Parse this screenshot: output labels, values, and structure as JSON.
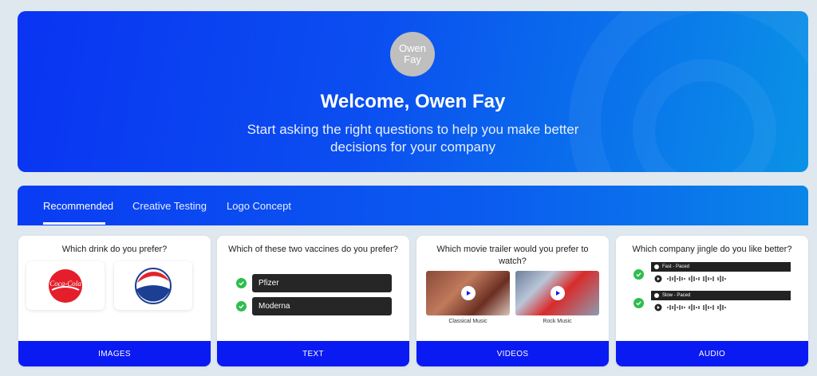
{
  "hero": {
    "avatar_text": "Owen Fay",
    "welcome": "Welcome, Owen Fay",
    "subtitle": "Start asking the right questions to help you make better decisions for your company"
  },
  "tabs": [
    {
      "label": "Recommended",
      "active": true
    },
    {
      "label": "Creative Testing",
      "active": false
    },
    {
      "label": "Logo Concept",
      "active": false
    }
  ],
  "cards": [
    {
      "question": "Which drink do you prefer?",
      "footer": "IMAGES",
      "options": [
        "Coca-Cola",
        "Pepsi"
      ]
    },
    {
      "question": "Which of these two vaccines do you prefer?",
      "footer": "TEXT",
      "options": [
        "Pfizer",
        "Moderna"
      ]
    },
    {
      "question": "Which movie trailer would you prefer to watch?",
      "footer": "VIDEOS",
      "options": [
        "Classical Music",
        "Rock Music"
      ]
    },
    {
      "question": "Which company jingle do you like better?",
      "footer": "AUDIO",
      "options": [
        "Fast - Paced",
        "Slow - Paced"
      ]
    }
  ],
  "colors": {
    "accent": "#0a1af2",
    "check": "#2ebd4e",
    "coke": "#e41e2b",
    "pepsi_blue": "#1c3f94",
    "pepsi_red": "#e3232c"
  }
}
